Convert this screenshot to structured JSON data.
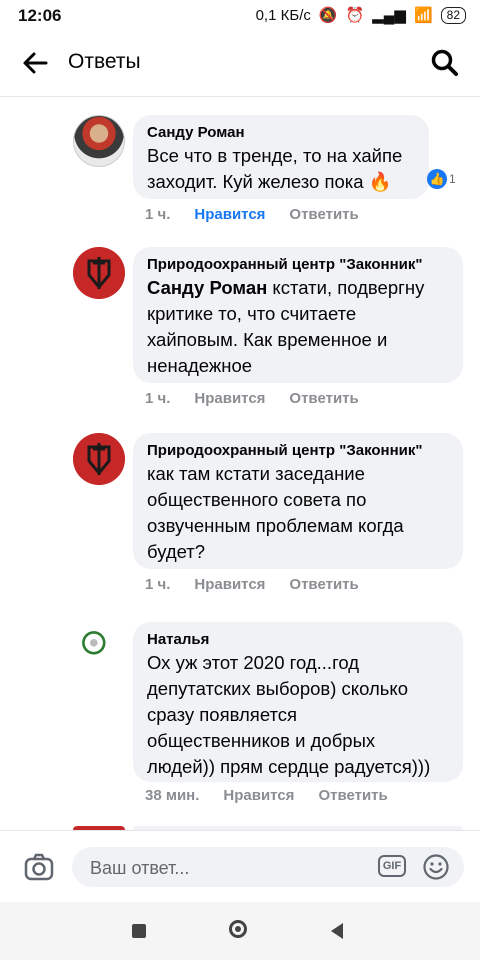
{
  "status": {
    "time": "12:06",
    "speed": "0,1 КБ/с",
    "battery": "82"
  },
  "header": {
    "title": "Ответы"
  },
  "comments": [
    {
      "author": "Санду Роман",
      "lines": [
        "Все что в тренде, то на хайпе",
        "заходит. Куй железо пока 🔥"
      ],
      "time": "1 ч.",
      "like": "Нравится",
      "reply": "Ответить",
      "reaction_count": "1"
    },
    {
      "author": "Природоохранный центр \"Законник\"",
      "mention": "Санду Роман",
      "lines_after_mention": " кстати, подвергну",
      "lines": [
        "критике то, что считаете",
        "хайповым. Как временное и",
        "ненадежное"
      ],
      "time": "1 ч.",
      "like": "Нравится",
      "reply": "Ответить"
    },
    {
      "author": "Природоохранный центр \"Законник\"",
      "lines": [
        "как там кстати заседание",
        "общественного совета по",
        "озвученным проблемам когда",
        "будет?"
      ],
      "time": "1 ч.",
      "like": "Нравится",
      "reply": "Ответить"
    },
    {
      "author": "Наталья",
      "lines": [
        "Ох уж этот 2020 год...год",
        "депутатских выборов) сколько",
        "сразу появляется",
        "общественников и добрых",
        "людей)) прям сердце радуется)))"
      ],
      "time": "38 мин.",
      "like": "Нравится",
      "reply": "Ответить"
    }
  ],
  "composer": {
    "placeholder": "Ваш ответ...",
    "gif_label": "GIF"
  },
  "colors": {
    "accent": "#1877f2",
    "bubble": "#f0f2f5",
    "muted": "#8a8d91",
    "logo": "#c62828"
  }
}
